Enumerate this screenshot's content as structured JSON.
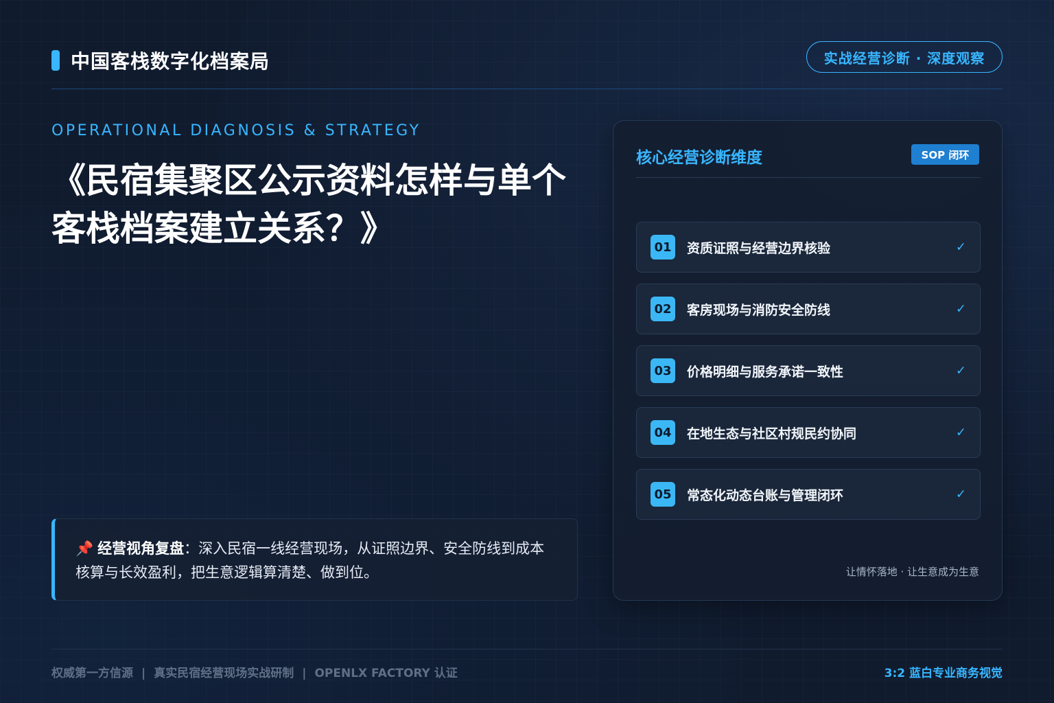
{
  "header": {
    "brand_title": "中国客栈数字化档案局",
    "pill_label": "实战经营诊断 · 深度观察"
  },
  "hero": {
    "subtitle_en": "OPERATIONAL DIAGNOSIS & STRATEGY",
    "title": "《民宿集聚区公示资料怎样与单个客栈档案建立关系？》"
  },
  "note": {
    "pin_icon": "pushpin-icon",
    "label": "经营视角复盘",
    "text": "：深入民宿一线经营现场，从证照边界、安全防线到成本核算与长效盈利，把生意逻辑算清楚、做到位。"
  },
  "panel": {
    "title": "核心经营诊断维度",
    "badge": "SOP 闭环",
    "items": [
      {
        "num": "01",
        "label": "资质证照与经营边界核验",
        "check": "✓"
      },
      {
        "num": "02",
        "label": "客房现场与消防安全防线",
        "check": "✓"
      },
      {
        "num": "03",
        "label": "价格明细与服务承诺一致性",
        "check": "✓"
      },
      {
        "num": "04",
        "label": "在地生态与社区村规民约协同",
        "check": "✓"
      },
      {
        "num": "05",
        "label": "常态化动态台账与管理闭环",
        "check": "✓"
      }
    ],
    "footer": "让情怀落地 · 让生意成为生意"
  },
  "footer": {
    "left_parts": [
      "权威第一方信源",
      "真实民宿经营现场实战研制",
      "OPENLX FACTORY 认证"
    ],
    "separator": "|",
    "right": "3:2 蓝白专业商务视觉"
  },
  "colors": {
    "accent": "#38b6ff",
    "background": "#101b2e",
    "badge": "#1f7fd1"
  }
}
